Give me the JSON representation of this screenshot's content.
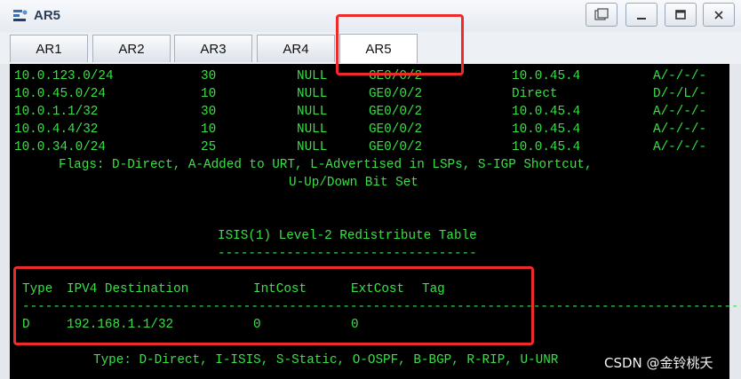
{
  "window": {
    "title": "AR5",
    "buttons": {
      "restore": "▣",
      "minimize": "—",
      "maximize": "☐",
      "close": "X"
    }
  },
  "tabs": [
    {
      "label": "AR1",
      "active": false
    },
    {
      "label": "AR2",
      "active": false
    },
    {
      "label": "AR3",
      "active": false
    },
    {
      "label": "AR4",
      "active": false
    },
    {
      "label": "AR5",
      "active": true
    }
  ],
  "routes": [
    {
      "destination": "10.0.123.0/24",
      "cost": "30",
      "ext": "NULL",
      "interface": "GE0/0/2",
      "nexthop": "10.0.45.4",
      "flags": "A/-/-/-"
    },
    {
      "destination": "10.0.45.0/24",
      "cost": "10",
      "ext": "NULL",
      "interface": "GE0/0/2",
      "nexthop": "Direct",
      "flags": "D/-/L/-"
    },
    {
      "destination": "10.0.1.1/32",
      "cost": "30",
      "ext": "NULL",
      "interface": "GE0/0/2",
      "nexthop": "10.0.45.4",
      "flags": "A/-/-/-"
    },
    {
      "destination": "10.0.4.4/32",
      "cost": "10",
      "ext": "NULL",
      "interface": "GE0/0/2",
      "nexthop": "10.0.45.4",
      "flags": "A/-/-/-"
    },
    {
      "destination": "10.0.34.0/24",
      "cost": "25",
      "ext": "NULL",
      "interface": "GE0/0/2",
      "nexthop": "10.0.45.4",
      "flags": "A/-/-/-"
    }
  ],
  "flags_line1": "Flags: D-Direct, A-Added to URT, L-Advertised in LSPs, S-IGP Shortcut,",
  "flags_line2": "U-Up/Down Bit Set",
  "redistribute": {
    "title": "ISIS(1) Level-2 Redistribute Table",
    "title_underline": "----------------------------------",
    "headers": {
      "type": "Type",
      "destination": "IPV4 Destination",
      "intcost": "IntCost",
      "extcost": "ExtCost",
      "tag": "Tag"
    },
    "separator": "-----------------------------------------------------------------------------------------------",
    "rows": [
      {
        "type": "D",
        "destination": "192.168.1.1/32",
        "intcost": "0",
        "extcost": "0"
      }
    ],
    "legend": "Type: D-Direct, I-ISIS, S-Static, O-OSPF, B-BGP, R-RIP, U-UNR"
  },
  "watermark": "CSDN @金铃桃夭",
  "highlight_color": "#ee2b2b",
  "terminal_text_color": "#39e046"
}
